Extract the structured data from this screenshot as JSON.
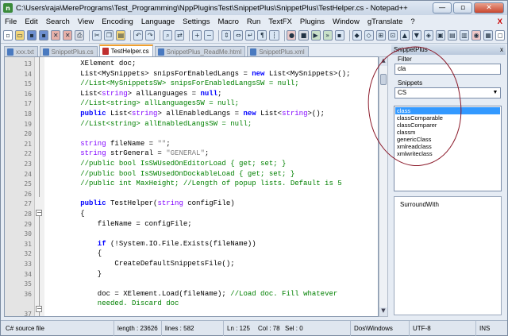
{
  "window": {
    "title": "C:\\Users\\raja\\MerePrograms\\Test_Programming\\NppPluginsTest\\SnippetPlus\\SnippetPlus\\TestHelper.cs - Notepad++",
    "close_label": "✕",
    "minimize_label": "—",
    "maximize_label": "▫"
  },
  "menu": [
    "File",
    "Edit",
    "Search",
    "View",
    "Encoding",
    "Language",
    "Settings",
    "Macro",
    "Run",
    "TextFX",
    "Plugins",
    "Window",
    "gTranslate",
    "?"
  ],
  "menu_close": "X",
  "tabs": [
    {
      "label": "xxx.txt",
      "active": false
    },
    {
      "label": "SnippetPlus.cs",
      "active": false
    },
    {
      "label": "TestHelper.cs",
      "active": true
    },
    {
      "label": "SnippetPlus_ReadMe.html",
      "active": false
    },
    {
      "label": "SnippetPlus.xml",
      "active": false
    }
  ],
  "editor": {
    "lines": [
      {
        "n": "13",
        "segs": [
          [
            "",
            "        XElement doc;"
          ]
        ]
      },
      {
        "n": "14",
        "segs": [
          [
            "",
            "        List<MySnippets> snipsForEnabledLangs = "
          ],
          [
            "kw",
            "new"
          ],
          [
            "",
            " List<MySnippets>();"
          ]
        ]
      },
      {
        "n": "15",
        "segs": [
          [
            "cm",
            "        //List<MySnippetsSW> snipsForEnabledLangsSW = null;"
          ]
        ]
      },
      {
        "n": "16",
        "segs": [
          [
            "",
            "        List<"
          ],
          [
            "ty",
            "string"
          ],
          [
            "",
            "> allLanguages = "
          ],
          [
            "kw",
            "null"
          ],
          [
            "",
            ";"
          ]
        ]
      },
      {
        "n": "17",
        "segs": [
          [
            "cm",
            "        //List<string> allLanguagesSW = null;"
          ]
        ]
      },
      {
        "n": "18",
        "segs": [
          [
            "kw",
            "        public"
          ],
          [
            "",
            " List<"
          ],
          [
            "ty",
            "string"
          ],
          [
            "",
            "> allEnabledLangs = "
          ],
          [
            "kw",
            "new"
          ],
          [
            "",
            " List<"
          ],
          [
            "ty",
            "string"
          ],
          [
            "",
            ">();"
          ]
        ]
      },
      {
        "n": "19",
        "segs": [
          [
            "cm",
            "        //List<string> allEnabledLangsSW = null;"
          ]
        ]
      },
      {
        "n": "20",
        "segs": [
          [
            "",
            ""
          ]
        ]
      },
      {
        "n": "21",
        "segs": [
          [
            "ty",
            "        string"
          ],
          [
            "",
            " fileName = "
          ],
          [
            "st",
            "\"\""
          ],
          [
            "",
            ";"
          ]
        ]
      },
      {
        "n": "22",
        "segs": [
          [
            "ty",
            "        string"
          ],
          [
            "",
            " strGeneral = "
          ],
          [
            "st",
            "\"GENERAL\""
          ],
          [
            "",
            ";"
          ]
        ]
      },
      {
        "n": "23",
        "segs": [
          [
            "cm",
            "        //public bool IsSWUsedOnEditorLoad { get; set; }"
          ]
        ]
      },
      {
        "n": "24",
        "segs": [
          [
            "cm",
            "        //public bool IsSWUsedOnDockableLoad { get; set; }"
          ]
        ]
      },
      {
        "n": "25",
        "segs": [
          [
            "cm",
            "        //public int MaxHeight; //Length of popup lists. Default is 5"
          ]
        ]
      },
      {
        "n": "26",
        "segs": [
          [
            "",
            ""
          ]
        ]
      },
      {
        "n": "27",
        "segs": [
          [
            "kw",
            "        public"
          ],
          [
            "",
            " TestHelper("
          ],
          [
            "ty",
            "string"
          ],
          [
            "",
            " configFile)"
          ]
        ]
      },
      {
        "n": "28",
        "segs": [
          [
            "",
            "        {"
          ]
        ]
      },
      {
        "n": "29",
        "segs": [
          [
            "",
            "            fileName = configFile;"
          ]
        ]
      },
      {
        "n": "30",
        "segs": [
          [
            "",
            ""
          ]
        ]
      },
      {
        "n": "31",
        "segs": [
          [
            "kw",
            "            if"
          ],
          [
            "",
            " (!System.IO.File.Exists(fileName))"
          ]
        ]
      },
      {
        "n": "32",
        "segs": [
          [
            "",
            "            {"
          ]
        ]
      },
      {
        "n": "33",
        "segs": [
          [
            "",
            "                CreateDefaultSnippetsFile();"
          ]
        ]
      },
      {
        "n": "34",
        "segs": [
          [
            "",
            "            }"
          ]
        ]
      },
      {
        "n": "35",
        "segs": [
          [
            "",
            ""
          ]
        ]
      },
      {
        "n": "36",
        "segs": [
          [
            "",
            "            doc = XElement.Load(fileName); "
          ],
          [
            "cm",
            "//Load doc. Fill whatever"
          ]
        ]
      },
      {
        "n": "",
        "segs": [
          [
            "cm",
            "            needed. Discard doc"
          ]
        ]
      },
      {
        "n": "37",
        "segs": [
          [
            "",
            ""
          ]
        ]
      }
    ]
  },
  "panel": {
    "title": "SnippetPlus",
    "close_label": "x",
    "filter_label": "Filter",
    "filter_value": "cla",
    "snippets_label": "Snippets",
    "snippets_selected": "CS",
    "snippet_items": [
      "class",
      "classComparable",
      "classComparer",
      "classm",
      "genericClass",
      "xmlreadclass",
      "xmlwriteclass"
    ],
    "selected_item": "class",
    "surround_label": "SurroundWith"
  },
  "status": {
    "type": "C# source file",
    "length": "length : 23626",
    "lines": "lines : 582",
    "ln": "Ln : 125",
    "col": "Col : 78",
    "sel": "Sel : 0",
    "eol": "Dos\\Windows",
    "encoding": "UTF-8",
    "mode": "INS"
  },
  "colors": {
    "annotation_circle": "#8b1a2a",
    "selection": "#3399ff",
    "keyword": "#0000ff",
    "comment": "#008000",
    "type": "#8000ff"
  }
}
